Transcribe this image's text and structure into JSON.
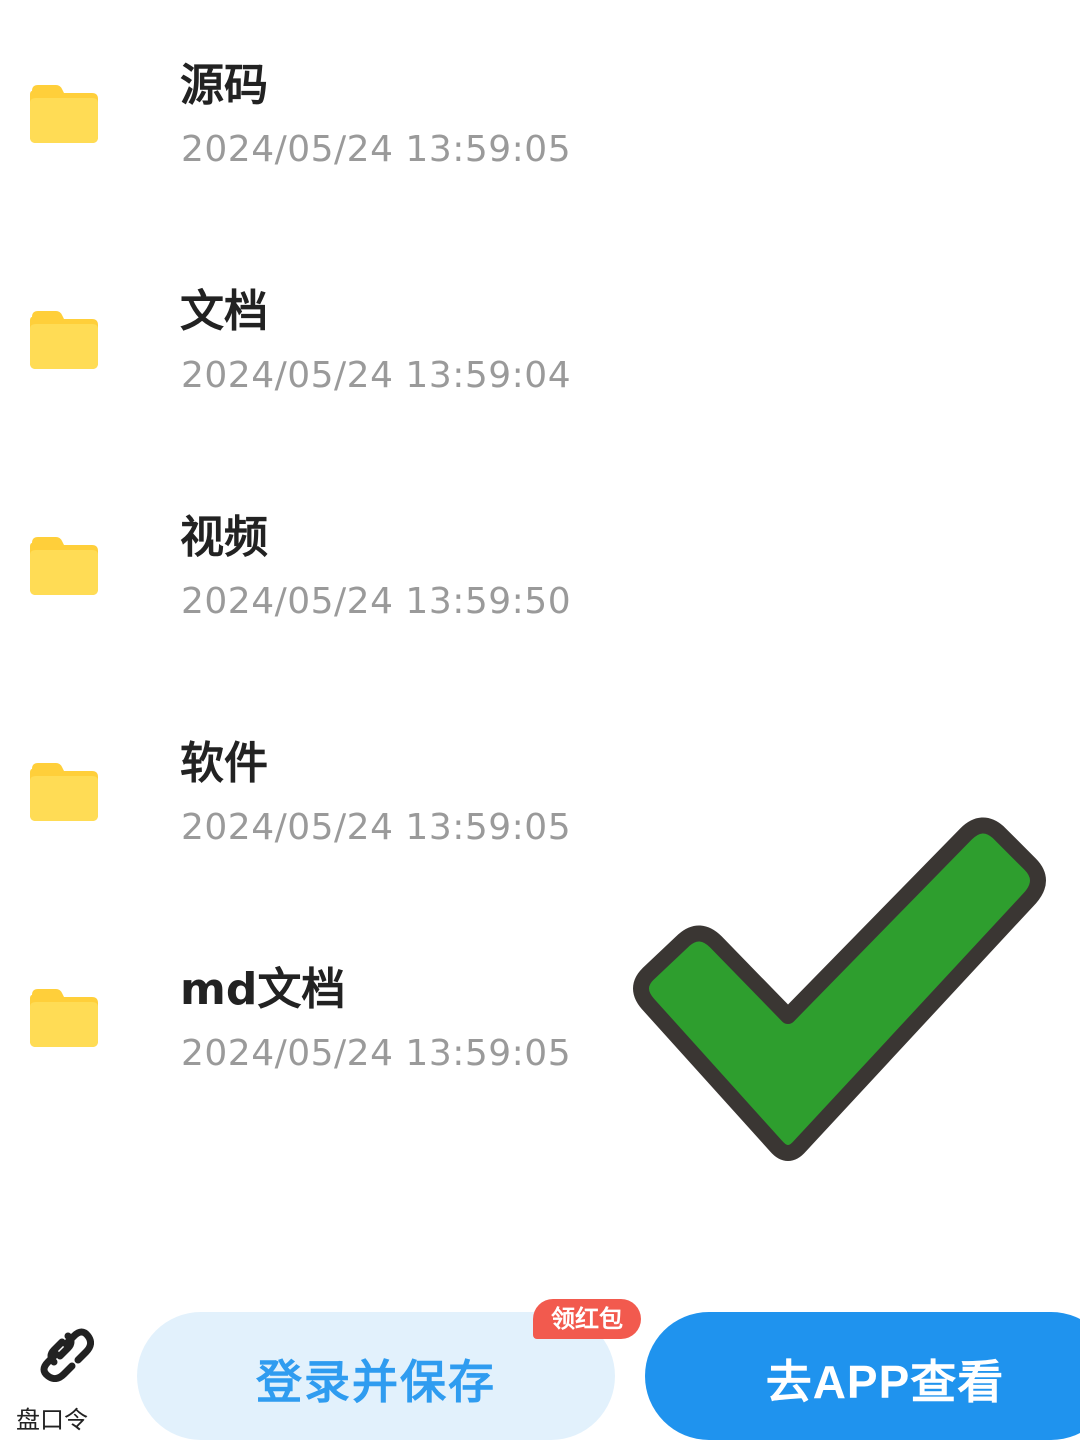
{
  "colors": {
    "folder": "#ffd84d",
    "folder_tab": "#ffcf3a",
    "filename": "#222222",
    "timestamp": "#9a9a9a",
    "check_fill": "#2e9e2e",
    "check_outline": "#3a3633",
    "login_bg": "#e2f1fc",
    "login_text": "#2f9cf0",
    "app_bg": "#1f93ee",
    "badge_bg": "#f25a4e"
  },
  "files": [
    {
      "name": "源码",
      "time": "2024/05/24 13:59:05",
      "icon": "folder-icon"
    },
    {
      "name": "文档",
      "time": "2024/05/24 13:59:04",
      "icon": "folder-icon"
    },
    {
      "name": "视频",
      "time": "2024/05/24 13:59:50",
      "icon": "folder-icon"
    },
    {
      "name": "软件",
      "time": "2024/05/24 13:59:05",
      "icon": "folder-icon"
    },
    {
      "name": "md文档",
      "time": "2024/05/24 13:59:05",
      "icon": "folder-icon"
    }
  ],
  "overlay": {
    "icon": "green-checkmark-icon"
  },
  "bottom_bar": {
    "pankouling_icon": "link-icon",
    "pankouling_label": "盘口令",
    "login_save_label": "登录并保存",
    "badge_label": "领红包",
    "go_app_label": "去APP查看"
  }
}
